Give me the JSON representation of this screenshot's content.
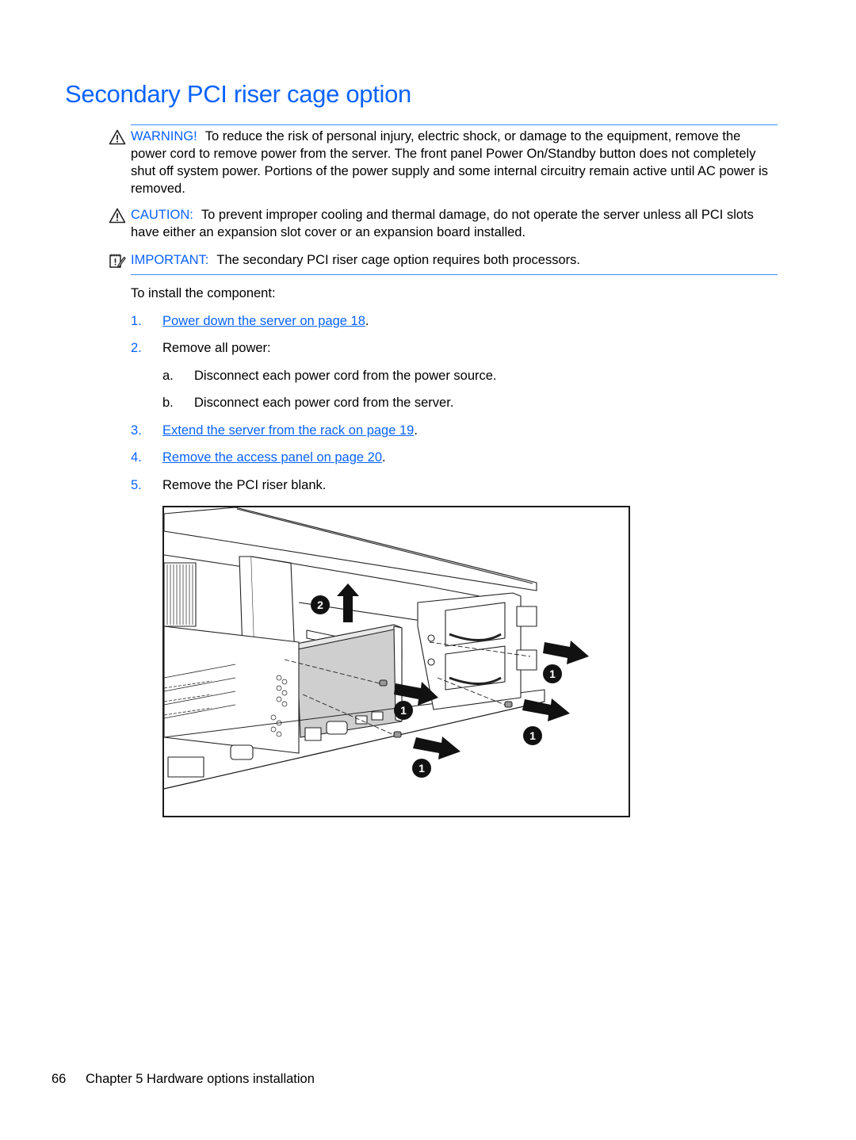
{
  "page": {
    "title": "Secondary PCI riser cage option",
    "colors": {
      "accent": "#0a63ff",
      "rule": "#3d8cff",
      "text": "#000000"
    }
  },
  "notices": [
    {
      "type": "warning",
      "icon": "warning-triangle-icon",
      "label": "WARNING!",
      "text": "To reduce the risk of personal injury, electric shock, or damage to the equipment, remove the power cord to remove power from the server. The front panel Power On/Standby button does not completely shut off system power. Portions of the power supply and some internal circuitry remain active until AC power is removed."
    },
    {
      "type": "caution",
      "icon": "caution-triangle-icon",
      "label": "CAUTION:",
      "text": "To prevent improper cooling and thermal damage, do not operate the server unless all PCI slots have either an expansion slot cover or an expansion board installed."
    },
    {
      "type": "important",
      "icon": "notepad-pencil-icon",
      "label": "IMPORTANT:",
      "text": "The secondary PCI riser cage option requires both processors."
    }
  ],
  "procedure": {
    "intro": "To install the component:",
    "steps": [
      {
        "num": "1.",
        "link": "Power down the server on page 18",
        "suffix": "."
      },
      {
        "num": "2.",
        "text": "Remove all power:",
        "substeps": [
          {
            "label": "a.",
            "text": "Disconnect each power cord from the power source."
          },
          {
            "label": "b.",
            "text": "Disconnect each power cord from the server."
          }
        ]
      },
      {
        "num": "3.",
        "link": "Extend the server from the rack on page 19",
        "suffix": "."
      },
      {
        "num": "4.",
        "link": "Remove the access panel on page 20",
        "suffix": "."
      },
      {
        "num": "5.",
        "text": "Remove the PCI riser blank."
      }
    ]
  },
  "figure": {
    "description": "Server rear view: remove screws (1) from PCI riser blank and power supply area, then lift riser blank (2)",
    "callouts": [
      "2",
      "1",
      "1",
      "1",
      "1"
    ]
  },
  "footer": {
    "page_number": "66",
    "chapter": "Chapter 5   Hardware options installation"
  }
}
